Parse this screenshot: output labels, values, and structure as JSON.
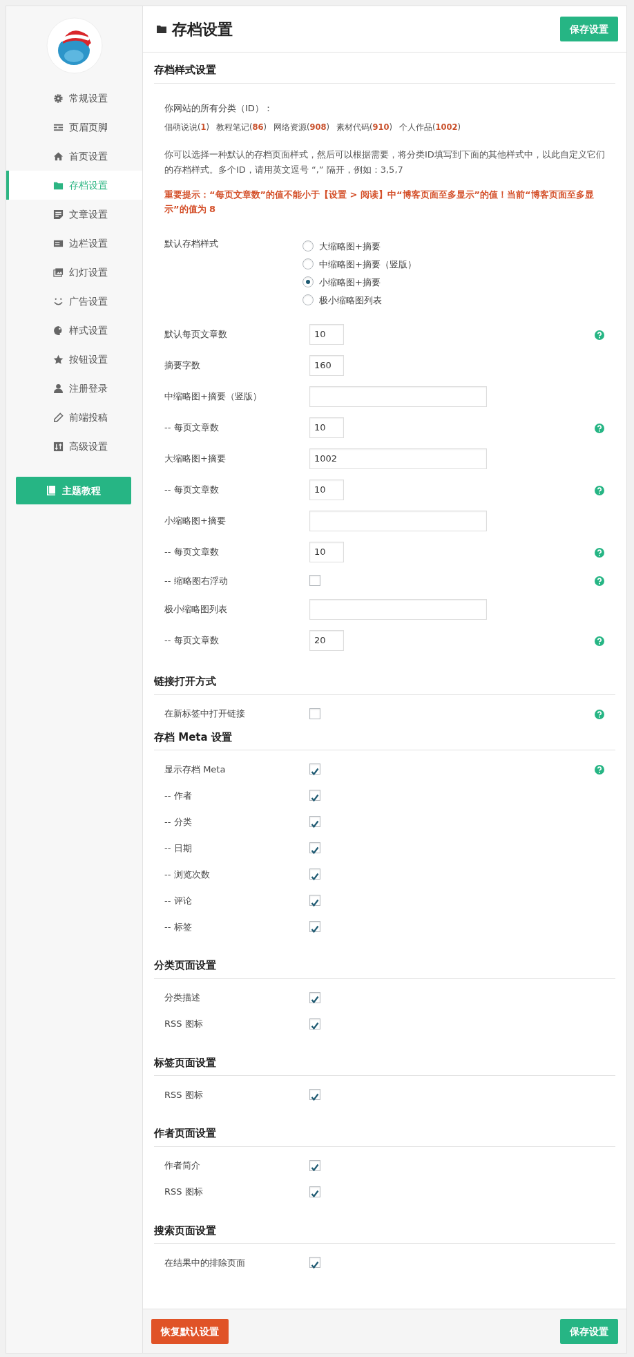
{
  "sidebar": {
    "items": [
      {
        "label": "常规设置",
        "selected": false
      },
      {
        "label": "页眉页脚",
        "selected": false
      },
      {
        "label": "首页设置",
        "selected": false
      },
      {
        "label": "存档设置",
        "selected": true
      },
      {
        "label": "文章设置",
        "selected": false
      },
      {
        "label": "边栏设置",
        "selected": false
      },
      {
        "label": "幻灯设置",
        "selected": false
      },
      {
        "label": "广告设置",
        "selected": false
      },
      {
        "label": "样式设置",
        "selected": false
      },
      {
        "label": "按钮设置",
        "selected": false
      },
      {
        "label": "注册登录",
        "selected": false
      },
      {
        "label": "前端投稿",
        "selected": false
      },
      {
        "label": "高级设置",
        "selected": false
      }
    ],
    "guide_button": "主题教程"
  },
  "header": {
    "title": "存档设置",
    "save_button": "保存设置"
  },
  "sections": [
    {
      "title": "存档样式设置",
      "intro": {
        "categories_label": "你网站的所有分类（ID）：",
        "categories": [
          "倡萌说说(**1**)",
          "教程笔记(**86**)",
          "网络资源(**908**)",
          "素材代码(**910**)",
          "个人作品(**1002**)"
        ],
        "description": "你可以选择一种默认的存档页面样式，然后可以根据需要，将分类ID填写到下面的其他样式中，以此自定义它们的存档样式。多个ID，请用英文逗号 “,” 隔开，例如：3,5,7",
        "warning": "重要提示：“每页文章数”的值不能小于【设置 > 阅读】中“博客页面至多显示”的值！当前“博客页面至多显示”的值为 8"
      },
      "rows": [
        {
          "kind": "radio",
          "label": "默认存档样式",
          "options": [
            {
              "label": "大缩略图+摘要",
              "selected": false
            },
            {
              "label": "中缩略图+摘要（竖版）",
              "selected": false
            },
            {
              "label": "小缩略图+摘要",
              "selected": true
            },
            {
              "label": "极小缩略图列表",
              "selected": false
            }
          ]
        },
        {
          "kind": "number",
          "label": "默认每页文章数",
          "value": "10",
          "help": true
        },
        {
          "kind": "number",
          "label": "摘要字数",
          "value": "160",
          "help": false
        },
        {
          "kind": "text",
          "label": "中缩略图+摘要（竖版）",
          "help": false
        },
        {
          "kind": "number",
          "label": "-- 每页文章数",
          "value": "10",
          "help": true
        },
        {
          "kind": "text",
          "label": "大缩略图+摘要",
          "value": "1002",
          "help": false
        },
        {
          "kind": "number",
          "label": "-- 每页文章数",
          "value": "10",
          "help": true
        },
        {
          "kind": "text",
          "label": "小缩略图+摘要",
          "help": false
        },
        {
          "kind": "number",
          "label": "-- 每页文章数",
          "value": "10",
          "help": true
        },
        {
          "kind": "checkbox",
          "label": "-- 缩略图右浮动",
          "checked": false,
          "help": true
        },
        {
          "kind": "text",
          "label": "极小缩略图列表",
          "help": false
        },
        {
          "kind": "number",
          "label": "-- 每页文章数",
          "value": "20",
          "help": true
        }
      ]
    },
    {
      "title": "链接打开方式",
      "rows": [
        {
          "kind": "checkbox",
          "label": "在新标签中打开链接",
          "checked": false,
          "help": true
        }
      ]
    },
    {
      "title": "存档 Meta 设置",
      "rows": [
        {
          "kind": "checkbox",
          "label": "显示存档 Meta",
          "checked": true,
          "help": true
        },
        {
          "kind": "checkbox",
          "label": "-- 作者",
          "checked": true,
          "help": false
        },
        {
          "kind": "checkbox",
          "label": "-- 分类",
          "checked": true,
          "help": false
        },
        {
          "kind": "checkbox",
          "label": "-- 日期",
          "checked": true,
          "help": false
        },
        {
          "kind": "checkbox",
          "label": "-- 浏览次数",
          "checked": true,
          "help": false
        },
        {
          "kind": "checkbox",
          "label": "-- 评论",
          "checked": true,
          "help": false
        },
        {
          "kind": "checkbox",
          "label": "-- 标签",
          "checked": true,
          "help": false
        }
      ]
    },
    {
      "title": "分类页面设置",
      "rows": [
        {
          "kind": "checkbox",
          "label": "分类描述",
          "checked": true,
          "help": false
        },
        {
          "kind": "checkbox",
          "label": "RSS 图标",
          "checked": true,
          "help": false
        }
      ]
    },
    {
      "title": "标签页面设置",
      "rows": [
        {
          "kind": "checkbox",
          "label": "RSS 图标",
          "checked": true,
          "help": false
        }
      ]
    },
    {
      "title": "作者页面设置",
      "rows": [
        {
          "kind": "checkbox",
          "label": "作者简介",
          "checked": true,
          "help": false
        },
        {
          "kind": "checkbox",
          "label": "RSS 图标",
          "checked": true,
          "help": false
        }
      ]
    },
    {
      "title": "搜索页面设置",
      "rows": [
        {
          "kind": "checkbox",
          "label": "在结果中的排除页面",
          "checked": true,
          "help": false
        }
      ]
    }
  ],
  "footer": {
    "reset_button": "恢复默认设置",
    "save_button": "保存设置"
  }
}
